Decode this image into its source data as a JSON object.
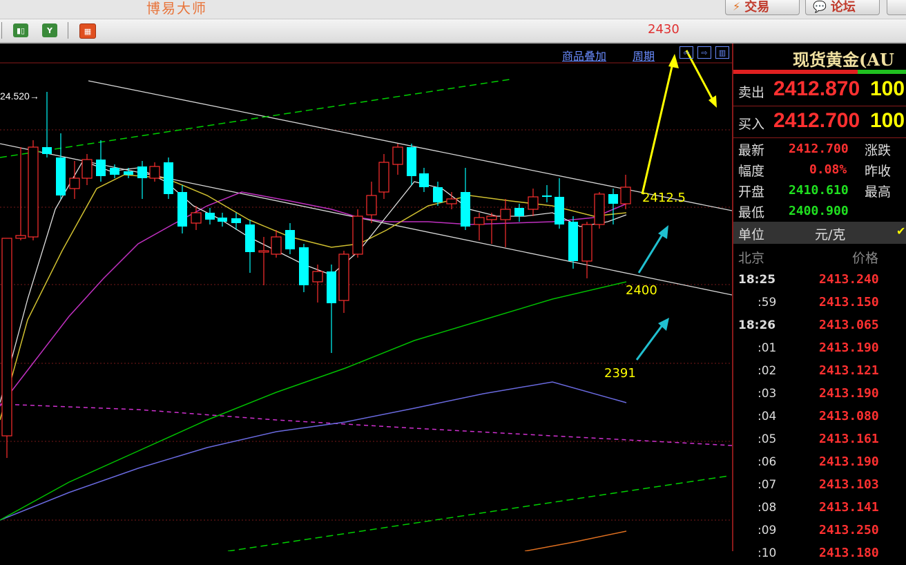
{
  "app": {
    "title": "博易大师"
  },
  "top_buttons": {
    "trade": "交易",
    "forum": "论坛"
  },
  "toolbar": {
    "price_note": "2430"
  },
  "chart_header": {
    "overlay_link": "商品叠加",
    "period_link": "周期"
  },
  "chart": {
    "high_label": "24.520→",
    "annotations": {
      "a2412": "2412.5",
      "a2400": "2400",
      "a2391": "2391"
    }
  },
  "panel": {
    "title": "现货黄金(AU",
    "sell": {
      "label": "卖出",
      "price": "2412.870",
      "vol": "100"
    },
    "buy": {
      "label": "买入",
      "price": "2412.700",
      "vol": "100"
    },
    "quote": {
      "latest_label": "最新",
      "latest": "2412.700",
      "change_label": "涨跌",
      "amp_label": "幅度",
      "amp": "0.08%",
      "prev_label": "昨收",
      "open_label": "开盘",
      "open": "2410.610",
      "high_label": "最高",
      "low_label": "最低",
      "low": "2400.900"
    },
    "unit": {
      "label": "单位",
      "value": "元/克",
      "check": "✔"
    },
    "ticks_header": {
      "time": "北京",
      "price": "价格"
    },
    "ticks": [
      {
        "time": "18:25",
        "price": "2413.240",
        "major": true
      },
      {
        "time": ":59",
        "price": "2413.150",
        "major": false
      },
      {
        "time": "18:26",
        "price": "2413.065",
        "major": true
      },
      {
        "time": ":01",
        "price": "2413.190",
        "major": false
      },
      {
        "time": ":02",
        "price": "2413.121",
        "major": false
      },
      {
        "time": ":03",
        "price": "2413.190",
        "major": false
      },
      {
        "time": ":04",
        "price": "2413.080",
        "major": false
      },
      {
        "time": ":05",
        "price": "2413.161",
        "major": false
      },
      {
        "time": ":06",
        "price": "2413.190",
        "major": false
      },
      {
        "time": ":07",
        "price": "2413.103",
        "major": false
      },
      {
        "time": ":08",
        "price": "2413.141",
        "major": false
      },
      {
        "time": ":09",
        "price": "2413.250",
        "major": false
      },
      {
        "time": ":10",
        "price": "2413.180",
        "major": false
      }
    ]
  },
  "colors": {
    "up": "#ff3030",
    "down": "#00ffff",
    "bg": "#000000",
    "accent_yellow": "#ffff00"
  }
}
